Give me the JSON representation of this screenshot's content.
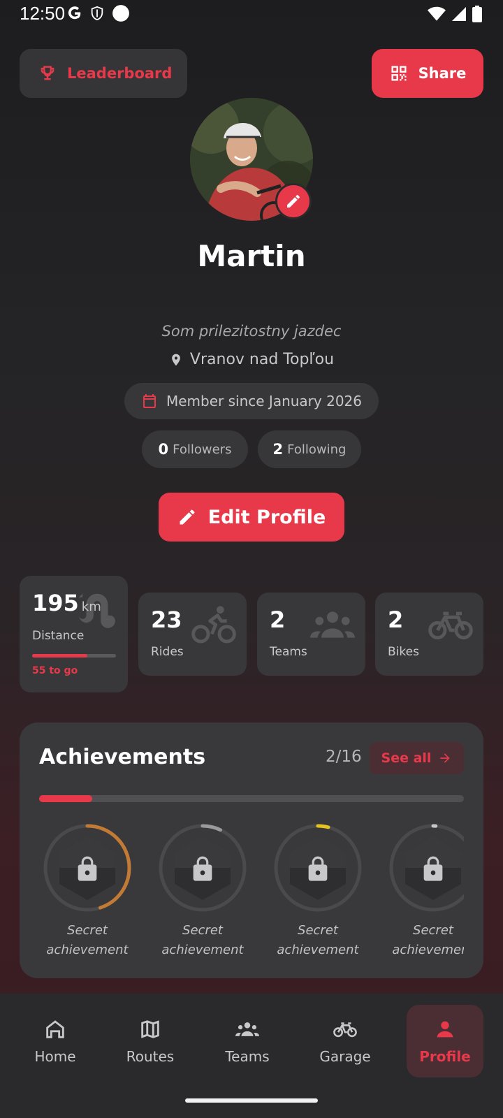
{
  "status_bar": {
    "time": "12:50"
  },
  "header": {
    "leaderboard_label": "Leaderboard",
    "share_label": "Share"
  },
  "profile": {
    "name": "Martin",
    "bio": "Som prilezitostny jazdec",
    "location": "Vranov nad Topľou",
    "member_since": "Member since January 2026",
    "followers_count": "0",
    "followers_label": "Followers",
    "following_count": "2",
    "following_label": "Following",
    "edit_label": "Edit Profile"
  },
  "stats": {
    "distance": {
      "value": "195",
      "unit": "km",
      "label": "Distance",
      "to_go": "55 to go",
      "progress": 0.66
    },
    "rides": {
      "value": "23",
      "label": "Rides"
    },
    "teams": {
      "value": "2",
      "label": "Teams"
    },
    "bikes": {
      "value": "2",
      "label": "Bikes"
    }
  },
  "achievements": {
    "title": "Achievements",
    "count": "2/16",
    "see_all": "See all",
    "progress": 0.125,
    "items": [
      {
        "label": "Secret\nachievement",
        "ring_color": "#c27a34",
        "ring_progress": 0.45
      },
      {
        "label": "Secret\nachievement",
        "ring_color": "#9a9a9c",
        "ring_progress": 0.07
      },
      {
        "label": "Secret\nachievement",
        "ring_color": "#e6c31f",
        "ring_progress": 0.04
      },
      {
        "label": "Secret\nachievement",
        "ring_color": "#c8c8ca",
        "ring_progress": 0.01
      }
    ]
  },
  "nav": {
    "items": [
      {
        "label": "Home",
        "icon": "home-icon"
      },
      {
        "label": "Routes",
        "icon": "map-icon"
      },
      {
        "label": "Teams",
        "icon": "groups-icon"
      },
      {
        "label": "Garage",
        "icon": "bike-icon"
      },
      {
        "label": "Profile",
        "icon": "person-icon",
        "active": true
      }
    ]
  },
  "colors": {
    "accent": "#e8394a",
    "card": "#38383b",
    "bg": "#1d1d1f"
  }
}
